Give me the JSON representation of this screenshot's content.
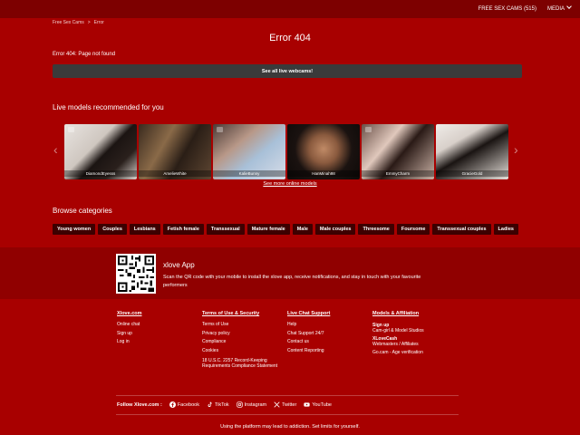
{
  "header": {
    "nav": [
      "FREE SEX CAMS (515)",
      "MEDIA"
    ]
  },
  "breadcrumb": {
    "home": "Free Sex Cams",
    "sep": ">",
    "current": "Error"
  },
  "main": {
    "title": "Error 404",
    "message": "Error 404: Page not found",
    "cta": "See all live webcams!",
    "recommended_title": "Live models recommended for you",
    "see_more": "See more online models",
    "models": [
      {
        "name": "DiamondEyesss"
      },
      {
        "name": "AmelieWhite"
      },
      {
        "name": "KalieBunny"
      },
      {
        "name": "HanMinah98"
      },
      {
        "name": "EmmyCharm"
      },
      {
        "name": "GracieGold"
      }
    ],
    "categories_title": "Browse categories",
    "categories": [
      "Young women",
      "Couples",
      "Lesbians",
      "Fetish female",
      "Transsexual",
      "Mature female",
      "Male",
      "Male couples",
      "Threesome",
      "Foursome",
      "Transsexual couples",
      "Ladies"
    ]
  },
  "app": {
    "title": "xlove App",
    "description": "Scan the QR code with your mobile to install the xlove app, receive notifications, and stay in touch with your favourite performers"
  },
  "footer": {
    "col1": {
      "title": "Xlove.com",
      "links": [
        "Online chat",
        "Sign up",
        "Log in"
      ]
    },
    "col2": {
      "title": "Terms of Use & Security",
      "links": [
        "Terms of Use",
        "Privacy policy",
        "Compliance",
        "Cookies",
        "18 U.S.C. 2257 Record-Keeping Requirements Compliance Statement"
      ]
    },
    "col3": {
      "title": "Live Chat Support",
      "links": [
        "Help",
        "Chat Support 24/7",
        "Contact us",
        "Content Reporting"
      ]
    },
    "col4": {
      "title": "Models & Affiliation",
      "items": [
        {
          "bold": "Sign up",
          "sub": "Cam-girl & Model Studios"
        },
        {
          "bold": "XLoveCash",
          "sub": "Webmasters / Affiliates"
        },
        {
          "bold": "",
          "sub": "Go.cam - Age verification"
        }
      ]
    },
    "follow_label": "Follow Xlove.com :",
    "socials": [
      "Facebook",
      "TikTok",
      "Instagram",
      "Twitter",
      "YouTube"
    ],
    "warning": "Using the platform may lead to addiction. Set limits for yourself."
  },
  "colors": {
    "background": "#a80000",
    "topbar": "#7d0000",
    "category_chip": "#3d0000",
    "cta": "#3a3a3a"
  }
}
